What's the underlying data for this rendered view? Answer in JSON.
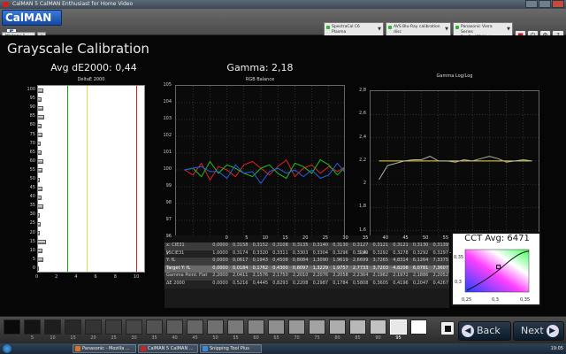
{
  "window": {
    "title": "CalMAN 5 CalMAN Enthusiast for Home Video"
  },
  "app": {
    "logo_text": "CalMAN",
    "logo_version": "5",
    "history_tab": "History 1",
    "add_tab": "+"
  },
  "sources": [
    {
      "line1": "SpectraCal C6",
      "line2": "Plasma"
    },
    {
      "line1": "AVS Blu-Ray calibration disc",
      "line2": ""
    },
    {
      "line1": "Panasonic Viera Series",
      "line2": "Pro 2 - ISF Night"
    }
  ],
  "toolbar_buttons": [
    {
      "name": "stop-sign-icon",
      "glyph": "■"
    },
    {
      "name": "power-icon",
      "glyph": "⏻"
    },
    {
      "name": "gear-icon",
      "glyph": "⚙"
    },
    {
      "name": "help-icon",
      "glyph": "?"
    },
    {
      "name": "window-icon",
      "glyph": "▭"
    }
  ],
  "page": {
    "title": "Grayscale Calibration"
  },
  "de_panel": {
    "title": "Avg dE2000: 0,44",
    "subtitle": "DeltaE 2000",
    "y_labels": [
      "100",
      "95",
      "90",
      "85",
      "80",
      "75",
      "70",
      "65",
      "60",
      "55",
      "50",
      "45",
      "40",
      "35",
      "30",
      "25",
      "20",
      "15",
      "10",
      "5",
      "0"
    ],
    "x_labels": [
      "0",
      "2",
      "4",
      "6",
      "8",
      "10"
    ],
    "threshold_colors": [
      "#18a018",
      "#e0e040",
      "#d02020"
    ]
  },
  "rgb_panel": {
    "title": "Gamma: 2,18",
    "subtitle": "RGB Balance",
    "y_labels": [
      "105",
      "104",
      "103",
      "102",
      "101",
      "100",
      "99",
      "98",
      "97",
      "96",
      "95"
    ],
    "x_labels": [
      "0",
      "10",
      "20",
      "30",
      "40",
      "50",
      "60",
      "70",
      "80",
      "90",
      "100"
    ]
  },
  "gamma_panel": {
    "subtitle": "Gamma Log/Log",
    "y_labels": [
      "2,8",
      "2,6",
      "2,4",
      "2,2",
      "2",
      "1,8",
      "1,6",
      "1,4"
    ],
    "x_labels": [
      "0",
      "10",
      "20",
      "30",
      "40",
      "50",
      "60",
      "70",
      "80",
      "90",
      "100"
    ]
  },
  "table": {
    "columns": [
      "0",
      "5",
      "10",
      "15",
      "20",
      "25",
      "30",
      "35",
      "40",
      "45",
      "50",
      "55"
    ],
    "rows": [
      {
        "label": "x: CIE31",
        "values": [
          "0,0000",
          "0,3158",
          "0,3152",
          "0,3108",
          "0,3135",
          "0,3140",
          "0,3130",
          "0,3127",
          "0,3121",
          "0,3121",
          "0,3130",
          "0,3139"
        ]
      },
      {
        "label": "y: CIE31",
        "values": [
          "1,0000",
          "0,3174",
          "0,3320",
          "0,3311",
          "0,3303",
          "0,3304",
          "0,3296",
          "0,3289",
          "0,3292",
          "0,3278",
          "0,3292",
          "0,3297"
        ]
      },
      {
        "label": "Y: fL",
        "values": [
          "0,0000",
          "0,0617",
          "0,1943",
          "0,4508",
          "0,8084",
          "1,3090",
          "1,9619",
          "2,6699",
          "3,7265",
          "4,8314",
          "6,1264",
          "7,3375"
        ]
      },
      {
        "label": "Target Y: fL",
        "values": [
          "0,0000",
          "0,0184",
          "0,1762",
          "0,4300",
          "0,8097",
          "1,3229",
          "1,9757",
          "2,7733",
          "3,7203",
          "4,8208",
          "6,0781",
          "7,3607"
        ]
      },
      {
        "label": "Gamma Point: Flat",
        "values": [
          "2,2000",
          "2,0411",
          "2,1576",
          "2,1750",
          "2,2010",
          "2,2076",
          "2,2058",
          "2,2364",
          "2,1982",
          "2,1972",
          "2,1886",
          "2,2052"
        ]
      },
      {
        "label": "ΔE 2000",
        "values": [
          "0,0000",
          "0,5216",
          "0,4445",
          "0,8293",
          "0,2208",
          "0,2987",
          "0,1784",
          "0,5808",
          "0,3605",
          "0,4196",
          "0,2047",
          "0,4267"
        ]
      }
    ]
  },
  "cct": {
    "title": "CCT Avg: 6471",
    "y_labels": [
      "0,35",
      "0,3"
    ],
    "x_labels": [
      "0,25",
      "0,3",
      "0,35"
    ]
  },
  "patches": [
    {
      "label": "",
      "color": "#0a0a0a"
    },
    {
      "label": "5",
      "color": "#141414"
    },
    {
      "label": "10",
      "color": "#1e1e1e"
    },
    {
      "label": "15",
      "color": "#282828"
    },
    {
      "label": "20",
      "color": "#333333"
    },
    {
      "label": "25",
      "color": "#3d3d3d"
    },
    {
      "label": "30",
      "color": "#474747"
    },
    {
      "label": "35",
      "color": "#525252"
    },
    {
      "label": "40",
      "color": "#5c5c5c"
    },
    {
      "label": "45",
      "color": "#666666"
    },
    {
      "label": "50",
      "color": "#707070"
    },
    {
      "label": "55",
      "color": "#7a7a7a"
    },
    {
      "label": "60",
      "color": "#858585"
    },
    {
      "label": "65",
      "color": "#8f8f8f"
    },
    {
      "label": "70",
      "color": "#999999"
    },
    {
      "label": "75",
      "color": "#a3a3a3"
    },
    {
      "label": "80",
      "color": "#adadad"
    },
    {
      "label": "85",
      "color": "#b8b8b8"
    },
    {
      "label": "90",
      "color": "#c2c2c2"
    },
    {
      "label": "95",
      "color": "#e8e8e8"
    },
    {
      "label": "",
      "color": "#ffffff"
    }
  ],
  "selected_patch": "95",
  "nav": {
    "back": "Back",
    "next": "Next",
    "back_glyph": "◀",
    "next_glyph": "▶"
  },
  "taskbar": {
    "items": [
      {
        "label": "Panasonic - Mozilla ...",
        "icon_color": "#e07020"
      },
      {
        "label": "CalMAN 5 CalMAN ...",
        "icon_color": "#cc2222"
      },
      {
        "label": "Snipping Tool Plus",
        "icon_color": "#3a8ad8"
      }
    ],
    "clock": "19:05"
  },
  "chart_data": [
    {
      "type": "bar",
      "title": "Avg dE2000: 0,44",
      "subtitle": "DeltaE 2000",
      "categories": [
        "0",
        "5",
        "10",
        "15",
        "20",
        "25",
        "30",
        "35",
        "40",
        "45",
        "50",
        "55",
        "60",
        "65",
        "70",
        "75",
        "80",
        "85",
        "90",
        "95",
        "100"
      ],
      "values": [
        0.0,
        0.52,
        0.44,
        0.83,
        0.22,
        0.3,
        0.18,
        0.58,
        0.36,
        0.42,
        0.2,
        0.43,
        0.55,
        0.35,
        0.25,
        0.45,
        0.4,
        0.6,
        0.5,
        0.35,
        0.55
      ],
      "orientation": "horizontal",
      "xlim": [
        0,
        11
      ],
      "xticks": [
        "0",
        "2",
        "4",
        "6",
        "8",
        "10"
      ],
      "thresholds": [
        3,
        5,
        10
      ]
    },
    {
      "type": "line",
      "title": "Gamma: 2,18",
      "subtitle": "RGB Balance",
      "x": [
        5,
        10,
        15,
        20,
        25,
        30,
        35,
        40,
        45,
        50,
        55,
        60,
        65,
        70,
        75,
        80,
        85,
        90,
        95,
        100
      ],
      "ylim": [
        95,
        105
      ],
      "series": [
        {
          "color": "#e02020",
          "values": [
            100.0,
            99.7,
            100.4,
            99.4,
            100.2,
            100.0,
            99.6,
            100.3,
            100.5,
            100.1,
            99.7,
            100.2,
            100.6,
            99.6,
            100.1,
            100.3,
            99.8,
            100.2,
            99.9,
            100.2
          ]
        },
        {
          "color": "#20c020",
          "values": [
            100.0,
            100.1,
            99.6,
            100.5,
            99.8,
            100.3,
            100.1,
            99.8,
            99.6,
            100.1,
            100.3,
            99.8,
            99.5,
            100.4,
            100.2,
            99.8,
            100.6,
            100.3,
            99.7,
            100.2
          ]
        },
        {
          "color": "#2060e0",
          "values": [
            100.0,
            100.1,
            100.2,
            99.9,
            99.9,
            99.5,
            100.3,
            99.8,
            99.9,
            99.2,
            99.9,
            100.1,
            99.8,
            100.0,
            99.6,
            100.0,
            99.5,
            99.7,
            100.4,
            99.8
          ]
        }
      ]
    },
    {
      "type": "line",
      "subtitle": "Gamma Log/Log",
      "x": [
        5,
        10,
        15,
        20,
        25,
        30,
        35,
        40,
        45,
        50,
        55,
        60,
        65,
        70,
        75,
        80,
        85,
        90,
        95
      ],
      "ylim": [
        1.4,
        2.8
      ],
      "series": [
        {
          "color": "#f0e020",
          "values": [
            2.2,
            2.2,
            2.2,
            2.2,
            2.2,
            2.2,
            2.2,
            2.2,
            2.2,
            2.2,
            2.2,
            2.2,
            2.2,
            2.2,
            2.2,
            2.2,
            2.2,
            2.2,
            2.2
          ]
        },
        {
          "color": "#b0b0b0",
          "values": [
            2.04,
            2.16,
            2.18,
            2.2,
            2.21,
            2.21,
            2.24,
            2.2,
            2.2,
            2.19,
            2.21,
            2.2,
            2.22,
            2.24,
            2.22,
            2.19,
            2.2,
            2.21,
            2.2
          ]
        }
      ]
    },
    {
      "type": "scatter",
      "title": "CCT Avg: 6471",
      "xlim": [
        0.25,
        0.37
      ],
      "ylim": [
        0.27,
        0.37
      ],
      "series": [
        {
          "name": "",
          "x": [
            0.3127
          ],
          "y": [
            0.329
          ]
        }
      ]
    }
  ]
}
